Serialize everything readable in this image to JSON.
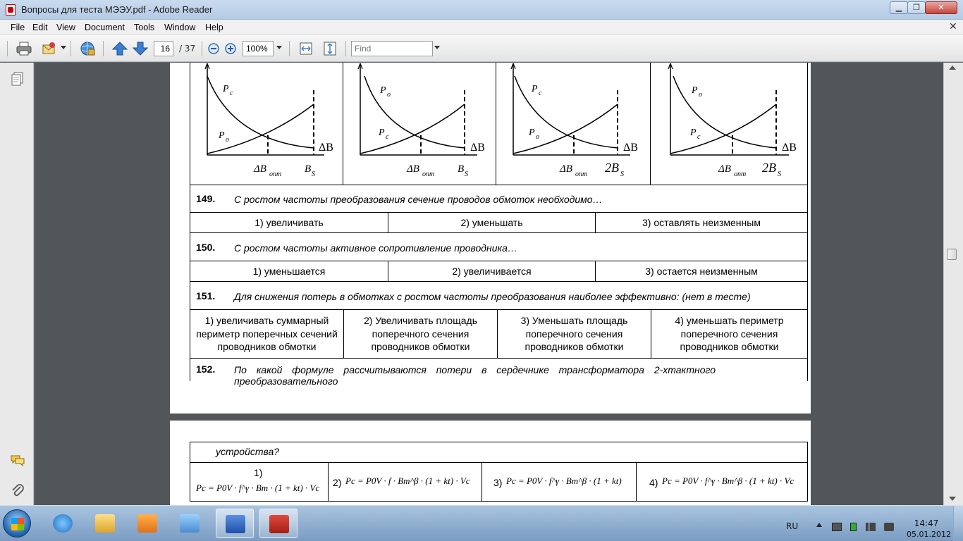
{
  "window": {
    "title": "Вопросы для теста МЭЭУ.pdf - Adobe Reader",
    "min_label": "▁",
    "max_label": "❐",
    "close_label": "✕"
  },
  "menu": {
    "file": "File",
    "edit": "Edit",
    "view": "View",
    "document": "Document",
    "tools": "Tools",
    "window": "Window",
    "help": "Help",
    "doc_close": "✕"
  },
  "toolbar": {
    "page_current": "16",
    "page_total": "/ 37",
    "zoom": "100%",
    "find_placeholder": "Find"
  },
  "graphs": [
    {
      "top_label": "P",
      "top_sub": "c",
      "bottom_label": "P",
      "bottom_sub": "o",
      "axis": "ΔB",
      "opt": "ΔB",
      "opt_sub": "опт",
      "sat": "B",
      "sat_sub": "S"
    },
    {
      "top_label": "P",
      "top_sub": "o",
      "bottom_label": "P",
      "bottom_sub": "c",
      "axis": "ΔB",
      "opt": "ΔB",
      "opt_sub": "опт",
      "sat": "B",
      "sat_sub": "S"
    },
    {
      "top_label": "P",
      "top_sub": "c",
      "bottom_label": "P",
      "bottom_sub": "o",
      "axis": "ΔB",
      "opt": "ΔB",
      "opt_sub": "опт",
      "sat": "2B",
      "sat_sub": "S"
    },
    {
      "top_label": "P",
      "top_sub": "o",
      "bottom_label": "P",
      "bottom_sub": "c",
      "axis": "ΔB",
      "opt": "ΔB",
      "opt_sub": "опт",
      "sat": "2B",
      "sat_sub": "S"
    }
  ],
  "questions": {
    "q149": {
      "num": "149.",
      "text": "С ростом частоты преобразования сечение проводов обмоток необходимо…",
      "answers": [
        "1) увеличивать",
        "2) уменьшать",
        "3) оставлять неизменным"
      ]
    },
    "q150": {
      "num": "150.",
      "text": "С ростом частоты активное сопротивление проводника…",
      "answers": [
        "1) уменьшается",
        "2) увеличивается",
        "3) остается неизменным"
      ]
    },
    "q151": {
      "num": "151.",
      "text": "Для снижения потерь в обмотках с ростом частоты преобразования наиболее эффективно: (нет в тесте)",
      "answers": [
        "1) увеличивать суммарный периметр поперечных сечений проводников обмотки",
        "2) Увеличивать площадь поперечного сечения проводников обмотки",
        "3) Уменьшать площадь поперечного сечения проводников обмотки",
        "4) уменьшать периметр поперечного сечения проводников обмотки"
      ]
    },
    "q152": {
      "num": "152.",
      "text": "По какой формуле рассчитываются потери в сердечнике трансформатора 2-хтактного преобразовательного",
      "continuation": "устройства?",
      "answers": [
        {
          "num": "1)",
          "formula": "Pc = P0V · f^γ · Bm · (1 + kt) · Vc"
        },
        {
          "num": "2)",
          "formula": "Pc = P0V · f · Bm^β · (1 + kt) · Vc"
        },
        {
          "num": "3)",
          "formula": "Pc = P0V · f^γ · Bm^β · (1 + kt)"
        },
        {
          "num": "4)",
          "formula": "Pc = P0V · f^γ · Bm^β · (1 + kt) · Vc"
        }
      ]
    }
  },
  "taskbar": {
    "lang": "RU",
    "time": "14:47",
    "date": "05.01.2012"
  },
  "icons": {
    "print": "printer-icon",
    "email": "email-icon",
    "security": "globe-icon",
    "prev": "arrow-up-icon",
    "next": "arrow-down-icon",
    "zoom_out": "zoom-out-icon",
    "zoom_in": "zoom-in-icon",
    "fit_width": "fit-width-icon",
    "fit_page": "fit-page-icon",
    "pages": "pages-icon",
    "comments": "comments-icon",
    "attachments": "paperclip-icon"
  },
  "colors": {
    "title_bar": "#b4cbe5",
    "toolbar": "#e4e4e4",
    "doc_bg": "#525659",
    "taskbar": "#7a9cc2",
    "close": "#c7463a"
  }
}
